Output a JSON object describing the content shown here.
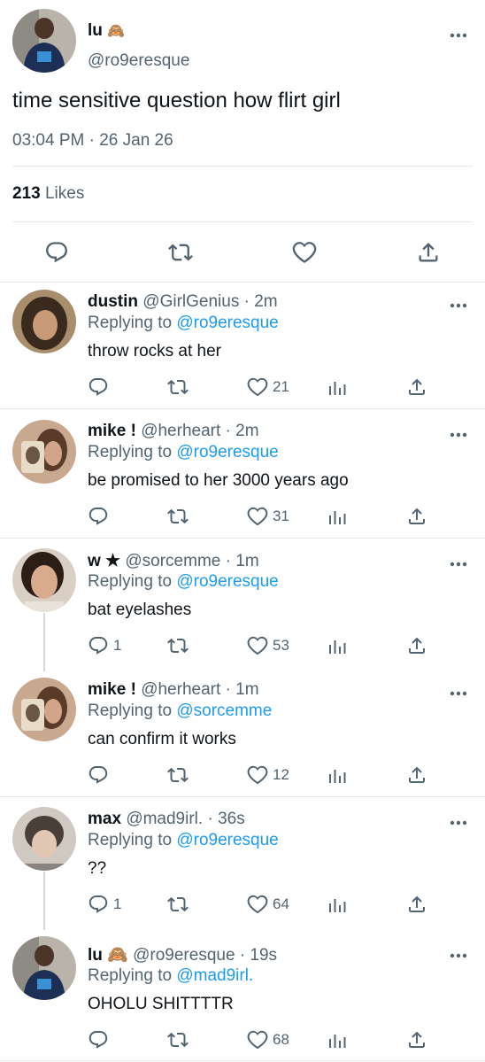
{
  "tweet": {
    "author_name": "lu",
    "author_emoji": "🙈",
    "author_handle": "@ro9eresque",
    "text": "time sensitive question how flirt girl",
    "time": "03:04 PM",
    "separator": "·",
    "date": "26 Jan 26",
    "likes_count": "213",
    "likes_label": "Likes"
  },
  "replies": [
    {
      "name": "dustin",
      "handle": "@GirlGenius",
      "time": "· 2m",
      "replying_prefix": "Replying to",
      "replying_to": "@ro9eresque",
      "text": "throw rocks at her",
      "reply_count": "",
      "like_count": "21"
    },
    {
      "name": "mike !",
      "handle": "@herheart",
      "time": "· 2m",
      "replying_prefix": "Replying to",
      "replying_to": "@ro9eresque",
      "text": "be promised to her 3000 years ago",
      "reply_count": "",
      "like_count": "31"
    },
    {
      "name": "w ★",
      "handle": "@sorcemme",
      "time": "· 1m",
      "replying_prefix": "Replying to",
      "replying_to": "@ro9eresque",
      "text": "bat eyelashes",
      "reply_count": "1",
      "like_count": "53"
    },
    {
      "name": "mike !",
      "handle": "@herheart",
      "time": "· 1m",
      "replying_prefix": "Replying to",
      "replying_to": "@sorcemme",
      "text": "can confirm it works",
      "reply_count": "",
      "like_count": "12"
    },
    {
      "name": "max",
      "handle": "@mad9irl.",
      "time": "· 36s",
      "replying_prefix": "Replying to",
      "replying_to": "@ro9eresque",
      "text": "??",
      "reply_count": "1",
      "like_count": "64"
    },
    {
      "name": "lu 🙈",
      "handle": "@ro9eresque",
      "time": "· 19s",
      "replying_prefix": "Replying to",
      "replying_to": "@mad9irl.",
      "text": "OHOLU SHITTTTR",
      "reply_count": "",
      "like_count": "68"
    }
  ],
  "icons": {
    "reply": "reply-icon",
    "retweet": "retweet-icon",
    "like": "heart-icon",
    "share": "share-icon",
    "analytics": "analytics-icon",
    "more": "more-icon"
  },
  "colors": {
    "link": "#1d9bf0",
    "muted": "#536471",
    "text": "#0f1419",
    "divider": "#e6e9eb"
  }
}
